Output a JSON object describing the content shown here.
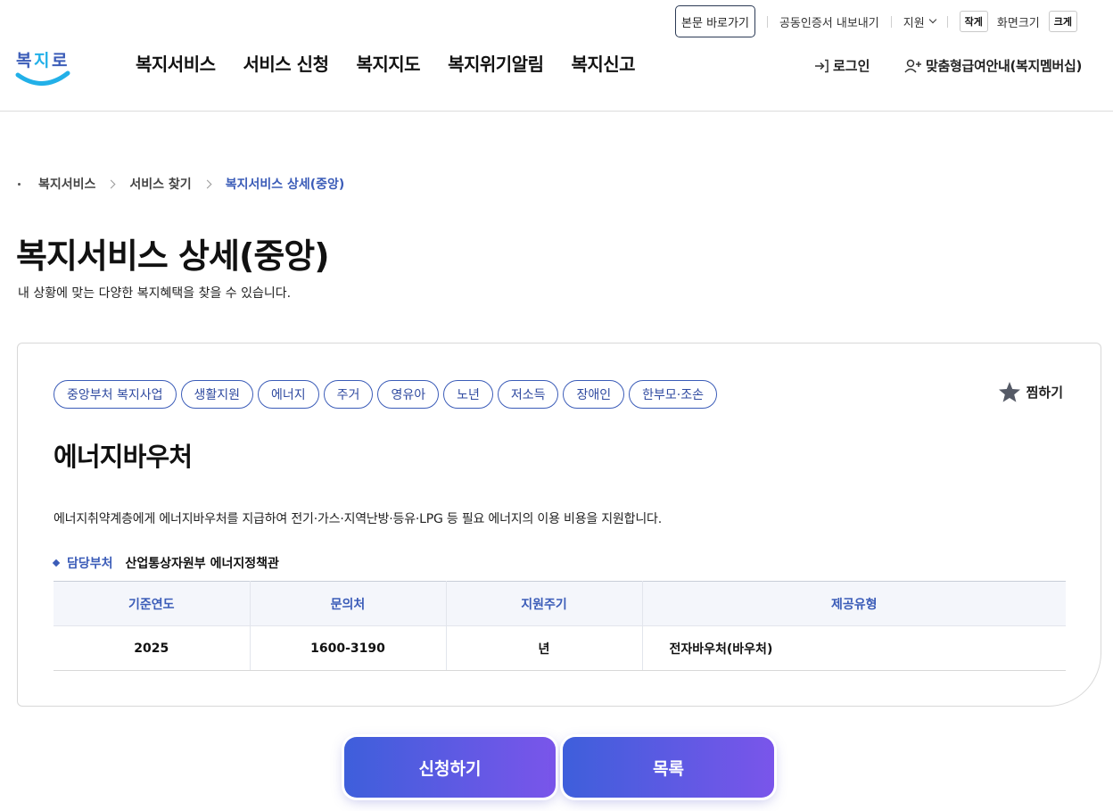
{
  "utility": {
    "skip_label": "본문 바로가기",
    "cert_label": "공동인증서 내보내기",
    "support_label": "지원",
    "small_label": "작게",
    "screen_size_label": "화면크기",
    "large_label": "크게"
  },
  "logo": {
    "text": "복지로",
    "colors": {
      "navy": "#3b5cb8",
      "sky": "#22b0e8"
    }
  },
  "nav": {
    "items": [
      {
        "label": "복지서비스"
      },
      {
        "label": "서비스 신청"
      },
      {
        "label": "복지지도"
      },
      {
        "label": "복지위기알림"
      },
      {
        "label": "복지신고"
      }
    ],
    "login_label": "로그인",
    "member_label": "맞춤형급여안내(복지멤버십)"
  },
  "breadcrumb": {
    "items": [
      {
        "label": "복지서비스"
      },
      {
        "label": "서비스 찾기"
      },
      {
        "label": "복지서비스 상세(중앙)"
      }
    ]
  },
  "page": {
    "title": "복지서비스 상세(중앙)",
    "description": "내 상황에 맞는 다양한 복지혜택을 찾을 수 있습니다."
  },
  "service": {
    "tags": [
      {
        "label": "중앙부처 복지사업"
      },
      {
        "label": "생활지원"
      },
      {
        "label": "에너지"
      },
      {
        "label": "주거"
      },
      {
        "label": "영유아"
      },
      {
        "label": "노년"
      },
      {
        "label": "저소득"
      },
      {
        "label": "장애인"
      },
      {
        "label": "한부모·조손"
      }
    ],
    "bookmark_label": "찜하기",
    "title": "에너지바우처",
    "description": "에너지취약계층에게 에너지바우처를 지급하여 전기·가스·지역난방·등유·LPG 등 필요 에너지의 이용 비용을 지원합니다.",
    "dept_label": "담당부처",
    "dept_value": "산업통상자원부 에너지정책관",
    "table": {
      "headers": [
        "기준연도",
        "문의처",
        "지원주기",
        "제공유형"
      ],
      "row": [
        "2025",
        "1600-3190",
        "년",
        "전자바우처(바우처)"
      ]
    }
  },
  "actions": {
    "apply_label": "신청하기",
    "list_label": "목록"
  },
  "colors": {
    "accent": "#3b5cb8",
    "button_gradient_start": "#3e5fdb",
    "button_gradient_end": "#7a55ea"
  }
}
